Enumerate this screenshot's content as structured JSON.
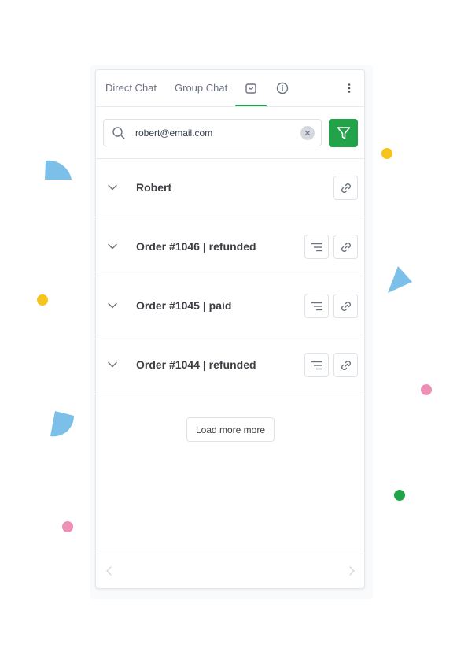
{
  "tabs": {
    "direct_chat": "Direct Chat",
    "group_chat": "Group Chat",
    "shop_icon": "shopping-bag-icon",
    "info_icon": "info-icon",
    "active": "shop"
  },
  "search": {
    "value": "robert@email.com",
    "placeholder": ""
  },
  "rows": [
    {
      "label": "Robert",
      "has_details": false
    },
    {
      "label": "Order #1046 | refunded",
      "has_details": true
    },
    {
      "label": "Order #1045 | paid",
      "has_details": true
    },
    {
      "label": "Order #1044 | refunded",
      "has_details": true
    }
  ],
  "load_more_label": "Load more more",
  "colors": {
    "accent_green": "#22a34a",
    "deco_blue": "#7cbfe9",
    "deco_yellow": "#f6c41a",
    "deco_pink": "#ee8fb6",
    "deco_green": "#22a34a"
  }
}
